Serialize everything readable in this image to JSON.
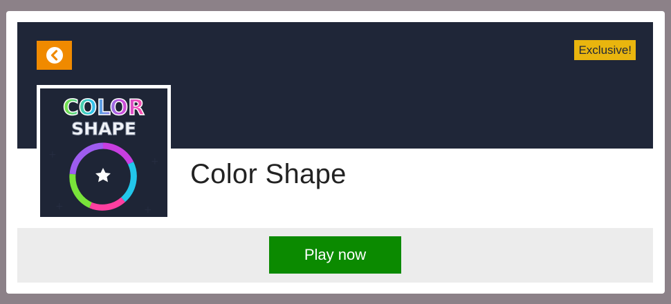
{
  "header": {
    "back_icon": "chevron-left-circle-icon",
    "badge": "Exclusive!",
    "back_color": "#f08a00",
    "badge_color": "#e9b50e",
    "banner_color": "#1f2638"
  },
  "game": {
    "title": "Color Shape",
    "thumbnail_logo_line1": "COLOR",
    "thumbnail_logo_line2": "SHAPE"
  },
  "actions": {
    "play_label": "Play now",
    "play_color": "#0b8a00"
  }
}
